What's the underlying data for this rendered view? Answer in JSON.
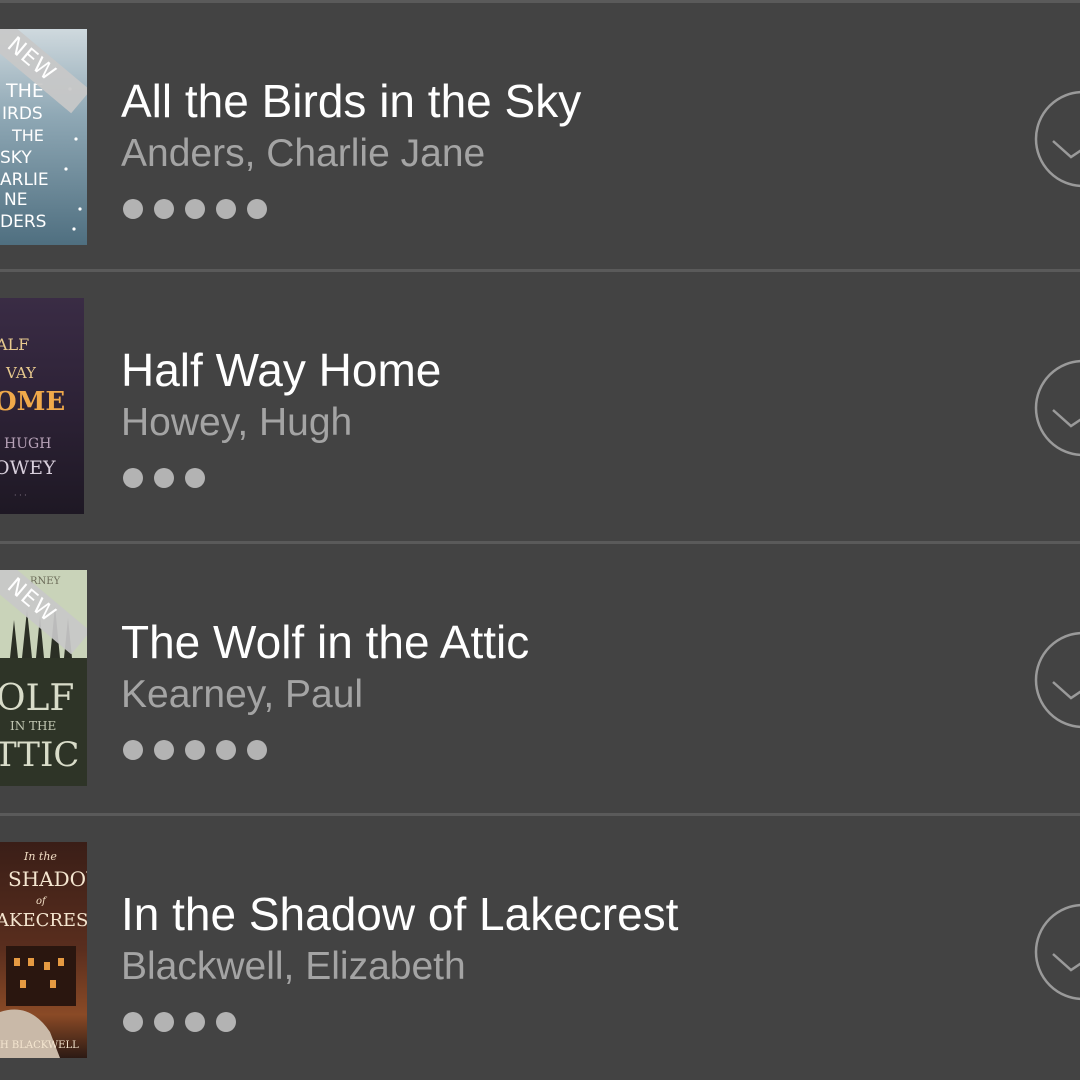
{
  "books": [
    {
      "title": "All the Birds in the Sky",
      "author": "Anders, Charlie Jane",
      "rating_dots": 5,
      "badge": "NEW",
      "cover_text": [
        "THE",
        "BIRDS",
        "IN THE",
        "SKY",
        "CHARLIE",
        "JANE",
        "ANDERS"
      ]
    },
    {
      "title": "Half Way Home",
      "author": "Howey, Hugh",
      "rating_dots": 3,
      "badge": "",
      "cover_text": [
        "HALF",
        "WAY",
        "HOME",
        "HUGH",
        "HOWEY"
      ]
    },
    {
      "title": "The Wolf in the Attic",
      "author": "Kearney, Paul",
      "rating_dots": 5,
      "badge": "NEW",
      "cover_text": [
        "KEARNEY",
        "WOLF",
        "IN THE",
        "ATTIC"
      ]
    },
    {
      "title": "In the Shadow of Lakecrest",
      "author": "Blackwell, Elizabeth",
      "rating_dots": 4,
      "badge": "",
      "cover_text": [
        "In the",
        "SHADOW",
        "of",
        "LAKECREST",
        "ELIZABETH BLACKWELL"
      ]
    }
  ],
  "icons": {
    "status": "circle-check-icon"
  },
  "colors": {
    "background": "#434343",
    "separator": "#5a5a5a",
    "title": "#ffffff",
    "author": "#a4a4a4",
    "dots": "#b3b3b3",
    "badge": "#c8c8c8"
  }
}
